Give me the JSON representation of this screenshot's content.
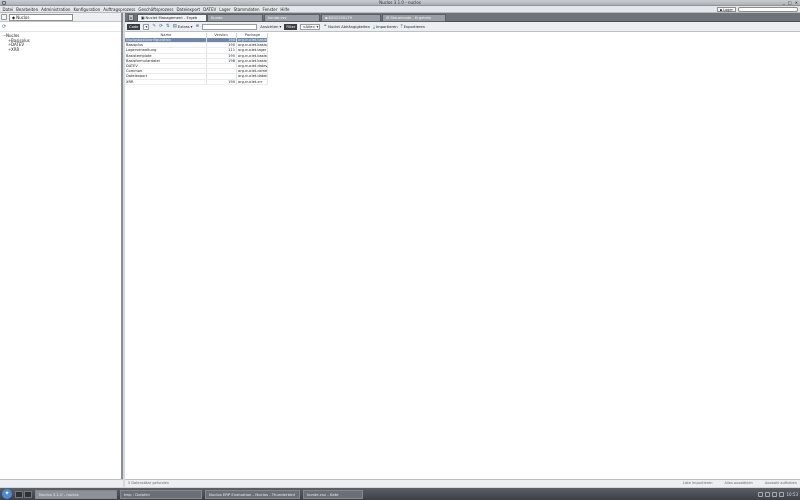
{
  "window": {
    "title": "Nuclos 3.1.0 - nuclos",
    "controls": [
      "_",
      "□",
      "✕"
    ]
  },
  "menu": [
    "Datei",
    "Bearbeiten",
    "Administration",
    "Konfiguration",
    "Auftragsprozess",
    "Geschäftsprozess",
    "Dateiexport",
    "DATEV",
    "Lager",
    "Stammdaten",
    "Fenster",
    "Hilfe"
  ],
  "menu_right": {
    "lager_label": "Lager",
    "search_placeholder": ""
  },
  "sidebar": {
    "tab_label": "Nuclos",
    "tree": {
      "root": "Nuclos",
      "children": [
        "Basisplus",
        "DATEV",
        "XRR"
      ]
    }
  },
  "tabs": [
    {
      "label": "Nuclet Management - Ergeb",
      "active": true
    },
    {
      "label": "Kunde",
      "active": false
    },
    {
      "label": "kunde.csv",
      "active": false
    },
    {
      "label": "8000190179",
      "active": false
    },
    {
      "label": "Steuercode - Ergebnis",
      "active": false
    }
  ],
  "toolbar": {
    "code_label": "Code",
    "extras_label": "Extras",
    "search_label": "Ansichten",
    "filter_label": "Filter",
    "filter_value": "<Alle>",
    "abh_label": "Nuclet Abhängigkeiten",
    "import_label": "Importieren",
    "export_label": "Exportieren"
  },
  "table": {
    "headers": [
      "Name",
      "Version",
      "Package"
    ],
    "rows": [
      {
        "name": "Nuclosbasiskonfiguration",
        "version": "168",
        "package": "org.nuclet.basisko"
      },
      {
        "name": "Basisplus",
        "version": "190",
        "package": "org.nuclet.basisplus"
      },
      {
        "name": "Lagerverwaltung",
        "version": "111",
        "package": "org.nuclet.lager"
      },
      {
        "name": "Basistemplate",
        "version": "195",
        "package": "org.nuclet.basisde"
      },
      {
        "name": "Basisformulardatei",
        "version": "198",
        "package": "org.nuclet.basisfo"
      },
      {
        "name": "DATEV",
        "version": "",
        "package": "org.nuclet.datev"
      },
      {
        "name": "Common",
        "version": "",
        "package": "org.nuclet.common"
      },
      {
        "name": "Dateiexport",
        "version": "",
        "package": "org.nuclet.dateiex"
      },
      {
        "name": "XRR",
        "version": "190",
        "package": "org.nuclet.xrr"
      }
    ],
    "selected_row": 0
  },
  "status": {
    "left": "5 Datensätze gefunden",
    "right": [
      "Liste importieren",
      "Alles auswählen",
      "Auswahl aufheben"
    ]
  },
  "taskbar": {
    "tasks": [
      "Nuclos 3.1.0 - nuclos",
      "tmp : Dolphin",
      "Nuclos ERP Evaluation - Nuclos - Thunderbird",
      "kunde.csv - Kate"
    ],
    "clock": "10:53"
  }
}
